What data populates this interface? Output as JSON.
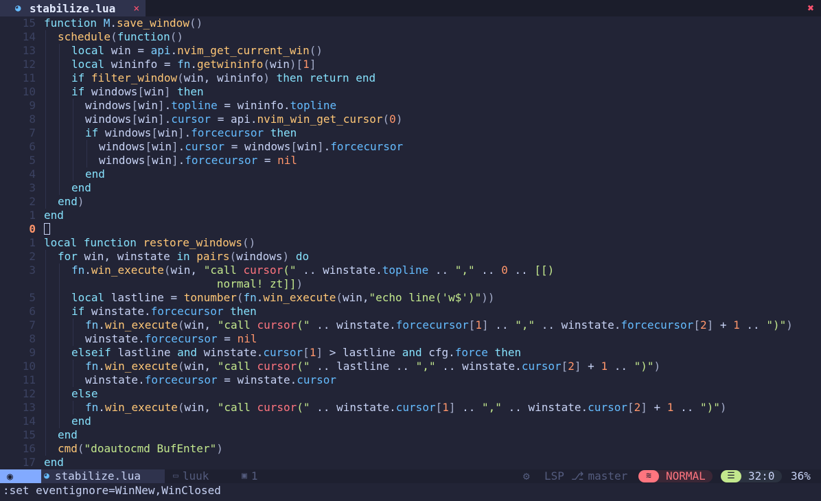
{
  "tab": {
    "filename": "stabilize.lua",
    "lua_icon": "lua-icon",
    "close_glyph": "×",
    "window_close_glyph": "✖"
  },
  "editor": {
    "lines": [
      {
        "num": "15",
        "rel": true,
        "segs": [
          [
            "k",
            "function "
          ],
          [
            "m",
            "M"
          ],
          [
            "v",
            "."
          ],
          [
            "f",
            "save_window"
          ],
          [
            "b",
            "()"
          ]
        ]
      },
      {
        "num": "14",
        "rel": true,
        "indent": 1,
        "segs": [
          [
            "f",
            "schedule"
          ],
          [
            "b",
            "("
          ],
          [
            "k",
            "function"
          ],
          [
            "b",
            "()"
          ]
        ]
      },
      {
        "num": "13",
        "rel": true,
        "indent": 2,
        "segs": [
          [
            "k",
            "local "
          ],
          [
            "v",
            "win = "
          ],
          [
            "m",
            "api"
          ],
          [
            "v",
            "."
          ],
          [
            "f",
            "nvim_get_current_win"
          ],
          [
            "b",
            "()"
          ]
        ]
      },
      {
        "num": "12",
        "rel": true,
        "indent": 2,
        "segs": [
          [
            "k",
            "local "
          ],
          [
            "v",
            "wininfo = "
          ],
          [
            "m",
            "fn"
          ],
          [
            "v",
            "."
          ],
          [
            "f",
            "getwininfo"
          ],
          [
            "b",
            "("
          ],
          [
            "v",
            "win"
          ],
          [
            "b",
            ")["
          ],
          [
            "n",
            "1"
          ],
          [
            "b",
            "]"
          ]
        ]
      },
      {
        "num": "11",
        "rel": true,
        "indent": 2,
        "segs": [
          [
            "k",
            "if "
          ],
          [
            "f",
            "filter_window"
          ],
          [
            "b",
            "("
          ],
          [
            "v",
            "win, wininfo"
          ],
          [
            "b",
            ") "
          ],
          [
            "k",
            "then return end"
          ]
        ]
      },
      {
        "num": "10",
        "rel": true,
        "indent": 2,
        "segs": [
          [
            "k",
            "if "
          ],
          [
            "v",
            "windows"
          ],
          [
            "b",
            "["
          ],
          [
            "v",
            "win"
          ],
          [
            "b",
            "] "
          ],
          [
            "k",
            "then"
          ]
        ]
      },
      {
        "num": "9",
        "rel": true,
        "indent": 3,
        "segs": [
          [
            "v",
            "windows"
          ],
          [
            "b",
            "["
          ],
          [
            "v",
            "win"
          ],
          [
            "b",
            "]"
          ],
          [
            "v",
            "."
          ],
          [
            "p",
            "topline"
          ],
          [
            "v",
            " = wininfo."
          ],
          [
            "p",
            "topline"
          ]
        ]
      },
      {
        "num": "8",
        "rel": true,
        "indent": 3,
        "segs": [
          [
            "v",
            "windows"
          ],
          [
            "b",
            "["
          ],
          [
            "v",
            "win"
          ],
          [
            "b",
            "]"
          ],
          [
            "v",
            "."
          ],
          [
            "p",
            "cursor"
          ],
          [
            "v",
            " = api."
          ],
          [
            "f",
            "nvim_win_get_cursor"
          ],
          [
            "b",
            "("
          ],
          [
            "n",
            "0"
          ],
          [
            "b",
            ")"
          ]
        ]
      },
      {
        "num": "7",
        "rel": true,
        "indent": 3,
        "segs": [
          [
            "k",
            "if "
          ],
          [
            "v",
            "windows"
          ],
          [
            "b",
            "["
          ],
          [
            "v",
            "win"
          ],
          [
            "b",
            "]"
          ],
          [
            "v",
            "."
          ],
          [
            "p",
            "forcecursor"
          ],
          [
            "k",
            " then"
          ]
        ]
      },
      {
        "num": "6",
        "rel": true,
        "indent": 4,
        "segs": [
          [
            "v",
            "windows"
          ],
          [
            "b",
            "["
          ],
          [
            "v",
            "win"
          ],
          [
            "b",
            "]"
          ],
          [
            "v",
            "."
          ],
          [
            "p",
            "cursor"
          ],
          [
            "v",
            " = windows"
          ],
          [
            "b",
            "["
          ],
          [
            "v",
            "win"
          ],
          [
            "b",
            "]"
          ],
          [
            "v",
            "."
          ],
          [
            "p",
            "forcecursor"
          ]
        ]
      },
      {
        "num": "5",
        "rel": true,
        "indent": 4,
        "segs": [
          [
            "v",
            "windows"
          ],
          [
            "b",
            "["
          ],
          [
            "v",
            "win"
          ],
          [
            "b",
            "]"
          ],
          [
            "v",
            "."
          ],
          [
            "p",
            "forcecursor"
          ],
          [
            "v",
            " = "
          ],
          [
            "n",
            "nil"
          ]
        ]
      },
      {
        "num": "4",
        "rel": true,
        "indent": 3,
        "segs": [
          [
            "k",
            "end"
          ]
        ]
      },
      {
        "num": "3",
        "rel": true,
        "indent": 2,
        "segs": [
          [
            "k",
            "end"
          ]
        ]
      },
      {
        "num": "2",
        "rel": true,
        "indent": 1,
        "segs": [
          [
            "k",
            "end"
          ],
          [
            "b",
            ")"
          ]
        ]
      },
      {
        "num": "1",
        "rel": true,
        "segs": [
          [
            "k",
            "end"
          ]
        ]
      },
      {
        "num": "0",
        "cur": true,
        "segs": [],
        "cursor": true
      },
      {
        "num": "1",
        "rel": true,
        "segs": [
          [
            "k",
            "local function "
          ],
          [
            "f",
            "restore_windows"
          ],
          [
            "b",
            "()"
          ]
        ]
      },
      {
        "num": "2",
        "rel": true,
        "indent": 1,
        "segs": [
          [
            "k",
            "for "
          ],
          [
            "v",
            "win, winstate "
          ],
          [
            "k",
            "in "
          ],
          [
            "f",
            "pairs"
          ],
          [
            "b",
            "("
          ],
          [
            "v",
            "windows"
          ],
          [
            "b",
            ") "
          ],
          [
            "k",
            "do"
          ]
        ]
      },
      {
        "num": "3",
        "rel": true,
        "indent": 2,
        "segs": [
          [
            "m",
            "fn"
          ],
          [
            "v",
            "."
          ],
          [
            "f",
            "win_execute"
          ],
          [
            "b",
            "("
          ],
          [
            "v",
            "win, "
          ],
          [
            "s",
            "\"call "
          ],
          [
            "e",
            "cursor"
          ],
          [
            "s",
            "(\""
          ],
          [
            "v",
            " .. winstate."
          ],
          [
            "p",
            "topline"
          ],
          [
            "v",
            " .. "
          ],
          [
            "s",
            "\",\""
          ],
          [
            "v",
            " .. "
          ],
          [
            "n",
            "0"
          ],
          [
            "v",
            " .. "
          ],
          [
            "s",
            "[[)"
          ]
        ]
      },
      {
        "num": "",
        "rel": true,
        "indent": 2,
        "wrap": true,
        "segs": [
          [
            "s",
            "                      normal! zt]]"
          ],
          [
            "b",
            ")"
          ]
        ]
      },
      {
        "num": "5",
        "rel": true,
        "indent": 2,
        "segs": [
          [
            "k",
            "local "
          ],
          [
            "v",
            "lastline = "
          ],
          [
            "f",
            "tonumber"
          ],
          [
            "b",
            "("
          ],
          [
            "m",
            "fn"
          ],
          [
            "v",
            "."
          ],
          [
            "f",
            "win_execute"
          ],
          [
            "b",
            "("
          ],
          [
            "v",
            "win,"
          ],
          [
            "s",
            "\"echo line('w$')\""
          ],
          [
            "b",
            "))"
          ]
        ]
      },
      {
        "num": "6",
        "rel": true,
        "indent": 2,
        "segs": [
          [
            "k",
            "if "
          ],
          [
            "v",
            "winstate."
          ],
          [
            "p",
            "forcecursor"
          ],
          [
            "k",
            " then"
          ]
        ]
      },
      {
        "num": "7",
        "rel": true,
        "indent": 3,
        "segs": [
          [
            "m",
            "fn"
          ],
          [
            "v",
            "."
          ],
          [
            "f",
            "win_execute"
          ],
          [
            "b",
            "("
          ],
          [
            "v",
            "win, "
          ],
          [
            "s",
            "\"call "
          ],
          [
            "e",
            "cursor"
          ],
          [
            "s",
            "(\""
          ],
          [
            "v",
            " .. winstate."
          ],
          [
            "p",
            "forcecursor"
          ],
          [
            "b",
            "["
          ],
          [
            "n",
            "1"
          ],
          [
            "b",
            "]"
          ],
          [
            "v",
            " .. "
          ],
          [
            "s",
            "\",\""
          ],
          [
            "v",
            " .. winstate."
          ],
          [
            "p",
            "forcecursor"
          ],
          [
            "b",
            "["
          ],
          [
            "n",
            "2"
          ],
          [
            "b",
            "]"
          ],
          [
            "v",
            " + "
          ],
          [
            "n",
            "1"
          ],
          [
            "v",
            " .. "
          ],
          [
            "s",
            "\")\""
          ],
          [
            "b",
            ")"
          ]
        ]
      },
      {
        "num": "8",
        "rel": true,
        "indent": 3,
        "segs": [
          [
            "v",
            "winstate."
          ],
          [
            "p",
            "forcecursor"
          ],
          [
            "v",
            " = "
          ],
          [
            "n",
            "nil"
          ]
        ]
      },
      {
        "num": "9",
        "rel": true,
        "indent": 2,
        "segs": [
          [
            "k",
            "elseif "
          ],
          [
            "v",
            "lastline "
          ],
          [
            "k",
            "and "
          ],
          [
            "v",
            "winstate."
          ],
          [
            "p",
            "cursor"
          ],
          [
            "b",
            "["
          ],
          [
            "n",
            "1"
          ],
          [
            "b",
            "]"
          ],
          [
            "v",
            " > lastline "
          ],
          [
            "k",
            "and "
          ],
          [
            "v",
            "cfg."
          ],
          [
            "p",
            "force"
          ],
          [
            "k",
            " then"
          ]
        ]
      },
      {
        "num": "10",
        "rel": true,
        "indent": 3,
        "segs": [
          [
            "m",
            "fn"
          ],
          [
            "v",
            "."
          ],
          [
            "f",
            "win_execute"
          ],
          [
            "b",
            "("
          ],
          [
            "v",
            "win, "
          ],
          [
            "s",
            "\"call "
          ],
          [
            "e",
            "cursor"
          ],
          [
            "s",
            "(\""
          ],
          [
            "v",
            " .. lastline .. "
          ],
          [
            "s",
            "\",\""
          ],
          [
            "v",
            " .. winstate."
          ],
          [
            "p",
            "cursor"
          ],
          [
            "b",
            "["
          ],
          [
            "n",
            "2"
          ],
          [
            "b",
            "]"
          ],
          [
            "v",
            " + "
          ],
          [
            "n",
            "1"
          ],
          [
            "v",
            " .. "
          ],
          [
            "s",
            "\")\""
          ],
          [
            "b",
            ")"
          ]
        ]
      },
      {
        "num": "11",
        "rel": true,
        "indent": 3,
        "segs": [
          [
            "v",
            "winstate."
          ],
          [
            "p",
            "forcecursor"
          ],
          [
            "v",
            " = winstate."
          ],
          [
            "p",
            "cursor"
          ]
        ]
      },
      {
        "num": "12",
        "rel": true,
        "indent": 2,
        "segs": [
          [
            "k",
            "else"
          ]
        ]
      },
      {
        "num": "13",
        "rel": true,
        "indent": 3,
        "segs": [
          [
            "m",
            "fn"
          ],
          [
            "v",
            "."
          ],
          [
            "f",
            "win_execute"
          ],
          [
            "b",
            "("
          ],
          [
            "v",
            "win, "
          ],
          [
            "s",
            "\"call "
          ],
          [
            "e",
            "cursor"
          ],
          [
            "s",
            "(\""
          ],
          [
            "v",
            " .. winstate."
          ],
          [
            "p",
            "cursor"
          ],
          [
            "b",
            "["
          ],
          [
            "n",
            "1"
          ],
          [
            "b",
            "]"
          ],
          [
            "v",
            " .. "
          ],
          [
            "s",
            "\",\""
          ],
          [
            "v",
            " .. winstate."
          ],
          [
            "p",
            "cursor"
          ],
          [
            "b",
            "["
          ],
          [
            "n",
            "2"
          ],
          [
            "b",
            "]"
          ],
          [
            "v",
            " + "
          ],
          [
            "n",
            "1"
          ],
          [
            "v",
            " .. "
          ],
          [
            "s",
            "\")\""
          ],
          [
            "b",
            ")"
          ]
        ]
      },
      {
        "num": "14",
        "rel": true,
        "indent": 2,
        "segs": [
          [
            "k",
            "end"
          ]
        ]
      },
      {
        "num": "15",
        "rel": true,
        "indent": 1,
        "segs": [
          [
            "k",
            "end"
          ]
        ]
      },
      {
        "num": "16",
        "rel": true,
        "indent": 1,
        "segs": [
          [
            "f",
            "cmd"
          ],
          [
            "b",
            "("
          ],
          [
            "s",
            "\"doautocmd BufEnter\""
          ],
          [
            "b",
            ")"
          ]
        ]
      },
      {
        "num": "17",
        "rel": true,
        "segs": [
          [
            "k",
            "end"
          ]
        ]
      }
    ]
  },
  "statusline": {
    "mode_icon": "neovim-icon",
    "filename": "stabilize.lua",
    "file_icon": "lua-icon",
    "directory": "luuk",
    "folder_icon": "folder-icon",
    "buffer_count": "1",
    "buffer_icon": "buffer-icon",
    "lsp_label": "LSP",
    "gear_icon": "gear-icon",
    "branch": "master",
    "branch_icon": "git-branch-icon",
    "mode": "NORMAL",
    "mode_icon_glyph": "wind-icon",
    "position": "32:0",
    "position_icon": "list-icon",
    "percent": "36%"
  },
  "cmdline": {
    "text": ":set eventignore=WinNew,WinClosed"
  },
  "colors": {
    "background": "#222436",
    "keyword": "#86e1fc",
    "function": "#ffc777",
    "string": "#c3e88d",
    "number": "#ff966c",
    "property": "#65bcff",
    "mode_normal": "#ff757f",
    "accent": "#82aaff"
  }
}
